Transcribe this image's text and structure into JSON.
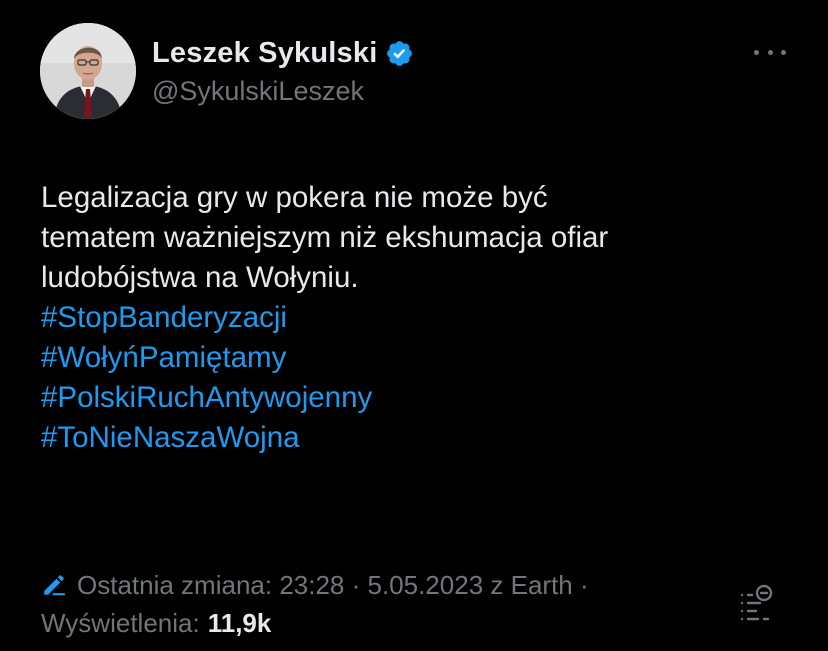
{
  "author": {
    "display_name": "Leszek Sykulski",
    "handle": "@SykulskiLeszek",
    "verified": true
  },
  "tweet": {
    "lines": [
      "Legalizacja gry w pokera nie może być",
      "tematem ważniejszym niż ekshumacja ofiar",
      "ludobójstwa na Wołyniu."
    ],
    "hashtags": [
      "#StopBanderyzacji",
      "#WołyńPamiętamy",
      "#PolskiRuchAntywojenny",
      "#ToNieNaszaWojna"
    ]
  },
  "meta": {
    "edited_prefix": "Ostatnia zmiana: 23:28 · 5.05.2023  z Earth ·",
    "views_label": "Wyświetlenia:",
    "views_value": "11,9k"
  },
  "colors": {
    "background": "#000000",
    "text": "#e7e9ea",
    "secondary": "#71767b",
    "accent": "#1d9bf0"
  },
  "icons": {
    "verified": "verified-badge-icon",
    "more": "more-options-icon",
    "edit": "pencil-icon",
    "edit_history": "edit-history-icon"
  }
}
